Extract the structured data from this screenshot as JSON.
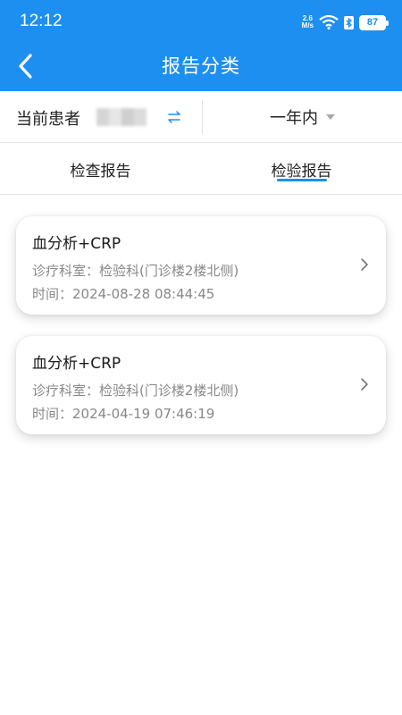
{
  "status_bar": {
    "time": "12:12",
    "net_speed_value": "2.6",
    "net_speed_unit": "M/s",
    "battery": "87"
  },
  "nav": {
    "title": "报告分类",
    "back_icon": "back-arrow-icon"
  },
  "filter": {
    "patient_label": "当前患者",
    "switch_icon": "switch-arrows-icon",
    "range_value": "一年内",
    "range_icon": "caret-down-icon"
  },
  "tabs": [
    {
      "label": "检查报告",
      "active": false
    },
    {
      "label": "检验报告",
      "active": true
    }
  ],
  "reports": [
    {
      "title": "血分析+CRP",
      "department": "诊疗科室：检验科(门诊楼2楼北侧)",
      "time": "时间：2024-08-28 08:44:45"
    },
    {
      "title": "血分析+CRP",
      "department": "诊疗科室：检验科(门诊楼2楼北侧)",
      "time": "时间：2024-04-19 07:46:19"
    }
  ],
  "colors": {
    "primary": "#1d8ff0",
    "text": "#222222",
    "secondary_text": "#888888"
  }
}
